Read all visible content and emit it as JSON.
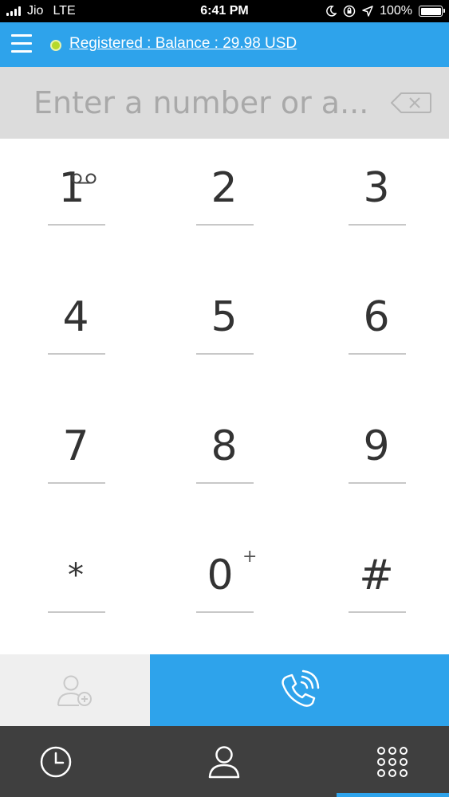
{
  "status_bar": {
    "carrier": "Jio",
    "network": "LTE",
    "time": "6:41 PM",
    "battery": "100%",
    "battery_level": 1.0,
    "icons": [
      "signal-icon",
      "moon-icon",
      "orientation-lock-icon",
      "location-icon",
      "battery-icon"
    ]
  },
  "header": {
    "registration_status": "Registered : Balance : 29.98 USD",
    "status_color": "#b6d92a",
    "accent_color": "#2ea3eb",
    "icons": [
      "menu-icon"
    ]
  },
  "dialer": {
    "number_value": "",
    "number_placeholder": "Enter a number or a...",
    "icons": [
      "backspace-icon"
    ]
  },
  "keypad": {
    "keys": [
      {
        "label": "1",
        "extra": "voicemail-icon"
      },
      {
        "label": "2"
      },
      {
        "label": "3"
      },
      {
        "label": "4"
      },
      {
        "label": "5"
      },
      {
        "label": "6"
      },
      {
        "label": "7"
      },
      {
        "label": "8"
      },
      {
        "label": "9"
      },
      {
        "label": "*"
      },
      {
        "label": "0",
        "extra": "+"
      },
      {
        "label": "#"
      }
    ]
  },
  "actions": {
    "icons": [
      "add-contact-icon",
      "call-icon"
    ]
  },
  "bottom_nav": {
    "items": [
      {
        "icon": "clock-icon",
        "active": false
      },
      {
        "icon": "person-icon",
        "active": false
      },
      {
        "icon": "keypad-icon",
        "active": true
      }
    ]
  }
}
